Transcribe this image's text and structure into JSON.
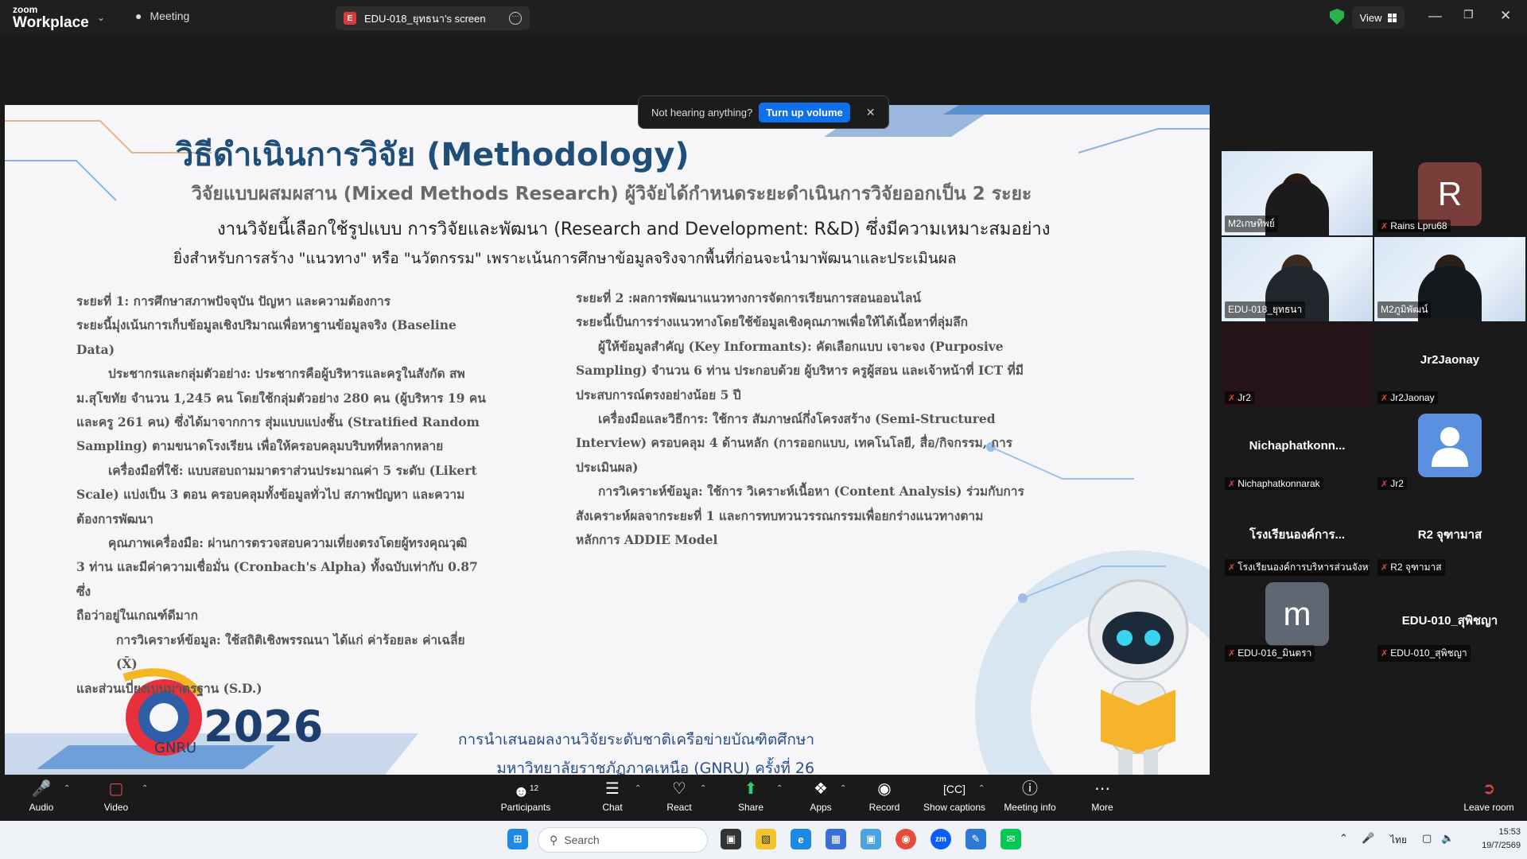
{
  "app": {
    "logo_small": "zoom",
    "logo_big": "Workplace"
  },
  "tabs": {
    "meeting": "Meeting",
    "share": "EDU-018_ยุทธนา's screen",
    "share_badge": "E"
  },
  "header": {
    "view": "View"
  },
  "toast": {
    "text": "Not hearing anything?",
    "button": "Turn up volume"
  },
  "slide": {
    "title": "วิธีดำเนินการวิจัย (Methodology)",
    "subtitle1": "วิจัยแบบผสมผสาน (Mixed Methods Research) ผู้วิจัยได้กำหนดระยะดำเนินการวิจัยออกเป็น 2 ระยะ",
    "subtitle2": "งานวิจัยนี้เลือกใช้รูปแบบ การวิจัยและพัฒนา (Research and Development: R&D) ซึ่งมีความเหมาะสมอย่าง",
    "subtitle3": "ยิ่งสำหรับการสร้าง \"แนวทาง\" หรือ \"นวัตกรรม\" เพราะเน้นการศึกษาข้อมูลจริงจากพื้นที่ก่อนจะนำมาพัฒนาและประเมินผล",
    "left": [
      "ระยะที่ 1: การศึกษาสภาพปัจจุบัน ปัญหา และความต้องการ",
      "ระยะนี้มุ่งเน้นการเก็บข้อมูลเชิงปริมาณเพื่อหาฐานข้อมูลจริง (Baseline",
      "Data)",
      "ประชากรและกลุ่มตัวอย่าง: ประชากรคือผู้บริหารและครูในสังกัด สพ",
      "ม.สุโขทัย จำนวน 1,245 คน โดยใช้กลุ่มตัวอย่าง 280 คน (ผู้บริหาร 19 คน",
      "และครู 261 คน) ซึ่งได้มาจากการ สุ่มแบบแบ่งชั้น (Stratified Random",
      "Sampling) ตามขนาดโรงเรียน เพื่อให้ครอบคลุมบริบทที่หลากหลาย",
      "เครื่องมือที่ใช้: แบบสอบถามมาตราส่วนประมาณค่า 5 ระดับ (Likert",
      "Scale) แบ่งเป็น 3 ตอน ครอบคลุมทั้งข้อมูลทั่วไป สภาพปัญหา และความ",
      "ต้องการพัฒนา",
      "คุณภาพเครื่องมือ: ผ่านการตรวจสอบความเที่ยงตรงโดยผู้ทรงคุณวุฒิ",
      "3 ท่าน และมีค่าความเชื่อมั่น (Cronbach's Alpha) ทั้งฉบับเท่ากับ 0.87 ซึ่ง",
      "ถือว่าอยู่ในเกณฑ์ดีมาก",
      "การวิเคราะห์ข้อมูล: ใช้สถิติเชิงพรรณนา ได้แก่ ค่าร้อยละ ค่าเฉลี่ย (X̄)",
      "และส่วนเบี่ยงเบนมาตรฐาน (S.D.)"
    ],
    "right": [
      "ระยะที่ 2 :ผลการพัฒนาแนวทางการจัดการเรียนการสอนออนไลน์",
      "ระยะนี้เป็นการร่างแนวทางโดยใช้ข้อมูลเชิงคุณภาพเพื่อให้ได้เนื้อหาที่ลุ่มลึก",
      "ผู้ให้ข้อมูลสำคัญ (Key Informants): คัดเลือกแบบ เจาะจง (Purposive",
      "Sampling) จำนวน 6 ท่าน ประกอบด้วย ผู้บริหาร ครูผู้สอน และเจ้าหน้าที่ ICT ที่มี",
      "ประสบการณ์ตรงอย่างน้อย 5 ปี",
      "เครื่องมือและวิธีการ: ใช้การ สัมภาษณ์กึ่งโครงสร้าง (Semi-Structured",
      "Interview) ครอบคลุม 4 ด้านหลัก (การออกแบบ, เทคโนโลยี, สื่อ/กิจกรรม, การ",
      "ประเมินผล)",
      "การวิเคราะห์ข้อมูล: ใช้การ วิเคราะห์เนื้อหา (Content Analysis) ร่วมกับการ",
      "สังเคราะห์ผลจากระยะที่ 1 และการทบทวนวรรณกรรมเพื่อยกร่างแนวทางตาม",
      "หลักการ ADDIE Model"
    ],
    "logo_year": "2026",
    "logo_name": "GNRU",
    "footer1": "การนำเสนอผลงานวิจัยระดับชาติเครือข่ายบัณฑิตศึกษา",
    "footer2": "มหาวิทยาลัยราชภัฏภาคเหนือ (GNRU) ครั้งที่ 26"
  },
  "participants": [
    {
      "name": "M2เกษทิพย์",
      "center": ""
    },
    {
      "name": "Rains Lpru68",
      "initial": "R",
      "color": "#7a3e3a"
    },
    {
      "name": "EDU-018_ยุทธนา"
    },
    {
      "name": "M2ภูมิพัฒน์"
    },
    {
      "name": "Jr2"
    },
    {
      "name": "Jr2Jaonay",
      "center": "Jr2Jaonay"
    },
    {
      "name": "Nichaphatkonnarak",
      "center": "Nichaphatkonn..."
    },
    {
      "name": "Jr2"
    },
    {
      "name": "โรงเรียนองค์การบริหารส่วนจังหวั...",
      "center": "โรงเรียนองค์การ..."
    },
    {
      "name": "R2 จุฑามาส",
      "center": "R2 จุฑามาส"
    },
    {
      "name": "EDU-016_มินตรา",
      "initial": "m",
      "color": "#5f6872"
    },
    {
      "name": "EDU-010_สุพิชญา",
      "center": "EDU-010_สุพิชญา"
    }
  ],
  "toolbar": {
    "audio": "Audio",
    "video": "Video",
    "participants": "Participants",
    "participants_count": "12",
    "chat": "Chat",
    "react": "React",
    "share": "Share",
    "apps": "Apps",
    "record": "Record",
    "captions": "Show captions",
    "info": "Meeting info",
    "more": "More",
    "leave": "Leave room"
  },
  "taskbar": {
    "search": "Search",
    "lang": "ไทย",
    "time": "15:53",
    "date": "19/7/2569"
  }
}
